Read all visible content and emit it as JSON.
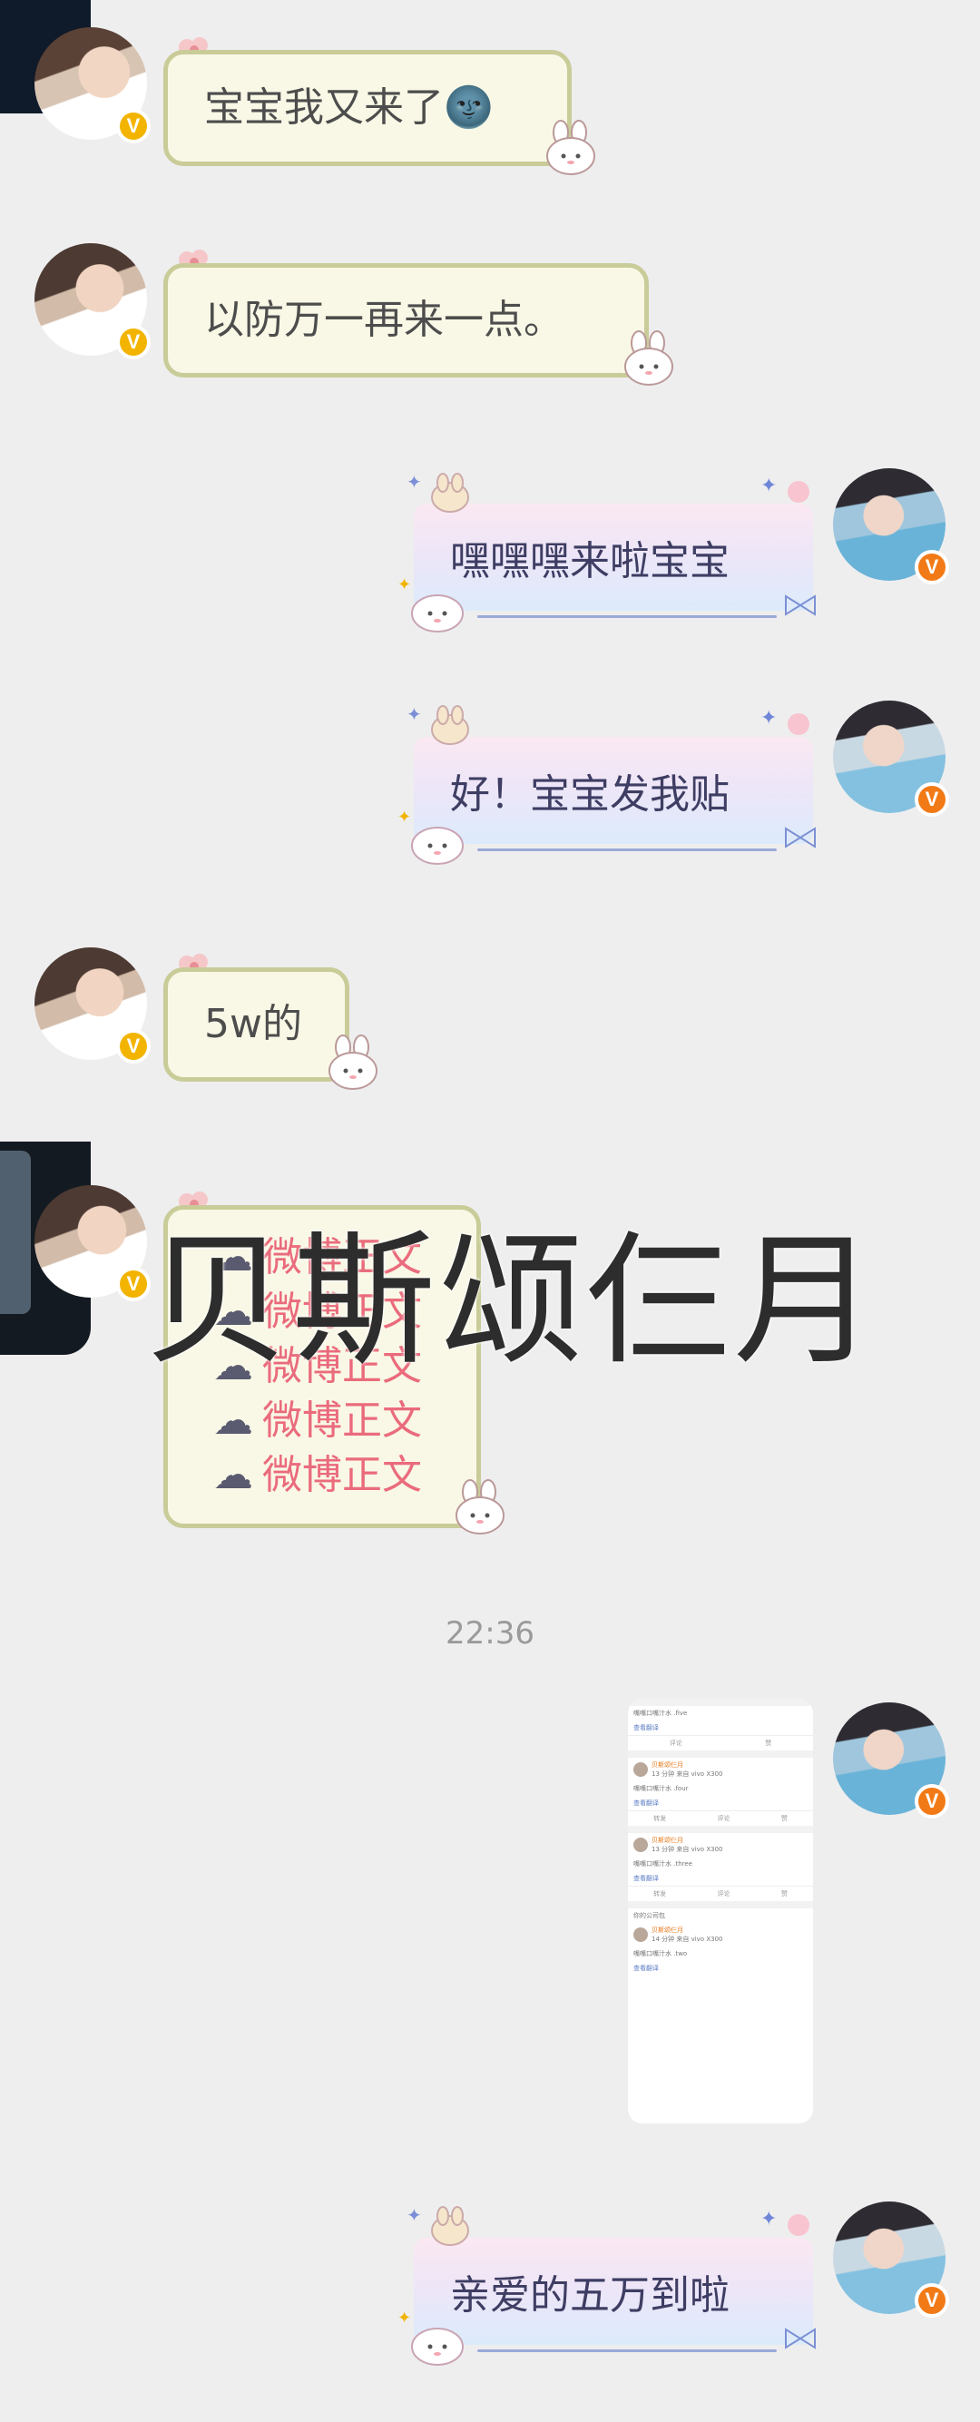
{
  "messages": [
    {
      "side": "left",
      "text": "宝宝我又来了🌚"
    },
    {
      "side": "left",
      "text": "以防万一再来一点。"
    },
    {
      "side": "right",
      "text": "嘿嘿嘿来啦宝宝"
    },
    {
      "side": "right",
      "text": "好！宝宝发我贴"
    },
    {
      "side": "left",
      "text": "5w的"
    },
    {
      "side": "right",
      "text": "亲爱的五万到啦"
    }
  ],
  "weibo_block": {
    "lines": [
      "微博正文",
      "微博正文",
      "微博正文",
      "微博正文",
      "微博正文"
    ]
  },
  "watermark": "贝斯颂仨月",
  "timestamp": "22:36",
  "screenshot_card": {
    "items": [
      {
        "tag": "嘴嘴口嘴汁水 .five",
        "translate": "查看翻译",
        "actions": [
          "转发",
          "评论",
          "赞"
        ]
      },
      {
        "name": "贝斯颂仨月",
        "meta": "13 分钟  来自 vivo X300",
        "tag": "嘴嘴口嘴汁水 .four",
        "translate": "查看翻译",
        "actions": [
          "转发",
          "评论",
          "赞"
        ]
      },
      {
        "name": "贝斯颂仨月",
        "meta": "13 分钟  来自 vivo X300",
        "tag": "嘴嘴口嘴汁水 .three",
        "translate": "查看翻译",
        "actions": [
          "转发",
          "评论",
          "赞"
        ]
      },
      {
        "header": "你的公司包",
        "name": "贝斯颂仨月",
        "meta": "14 分钟  来自 vivo X300",
        "tag": "嘴嘴口嘴汁水 .two",
        "translate": "查看翻译"
      }
    ]
  },
  "colors": {
    "background": "#eeeeef",
    "left_bubble": "#f9f8e6",
    "left_border": "#c9cc98",
    "right_bubble_top": "#fbe8f2",
    "right_bubble_bottom": "#dcebfb",
    "weibo_text": "#ea6b7c",
    "badge_gold": "#f3b400",
    "badge_orange": "#f27a16"
  },
  "icons": [
    "verified-badge-icon",
    "cloud-icon",
    "flower-deco-icon",
    "bunny-deco-icon",
    "sparkle-deco-icon",
    "ribbon-deco-icon"
  ]
}
